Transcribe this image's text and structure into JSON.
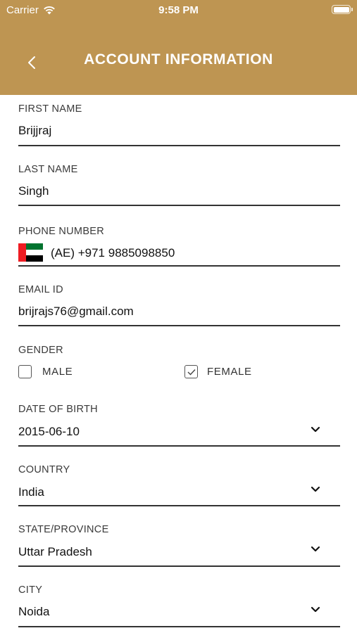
{
  "status_bar": {
    "carrier": "Carrier",
    "time": "9:58 PM"
  },
  "nav": {
    "title": "ACCOUNT INFORMATION",
    "back_icon": "chevron-left-icon"
  },
  "form": {
    "first_name": {
      "label": "FIRST NAME",
      "value": "Brijjraj"
    },
    "last_name": {
      "label": "LAST NAME",
      "value": "Singh"
    },
    "phone": {
      "label": "PHONE NUMBER",
      "value": "(AE) +971 9885098850",
      "flag": "uae-flag-icon"
    },
    "email": {
      "label": "EMAIL ID",
      "value": "brijrajs76@gmail.com"
    },
    "gender": {
      "label": "GENDER",
      "options": [
        {
          "label": "MALE",
          "checked": false
        },
        {
          "label": "FEMALE",
          "checked": true
        }
      ]
    },
    "dob": {
      "label": "DATE OF BIRTH",
      "value": "2015-06-10"
    },
    "country": {
      "label": "COUNTRY",
      "value": "India"
    },
    "state": {
      "label": "STATE/PROVINCE",
      "value": "Uttar Pradesh"
    },
    "city": {
      "label": "CITY",
      "value": "Noida"
    }
  },
  "colors": {
    "header": "#be9552",
    "underline": "#333333",
    "uae_red": "#ef1c23",
    "uae_green": "#00732f"
  }
}
